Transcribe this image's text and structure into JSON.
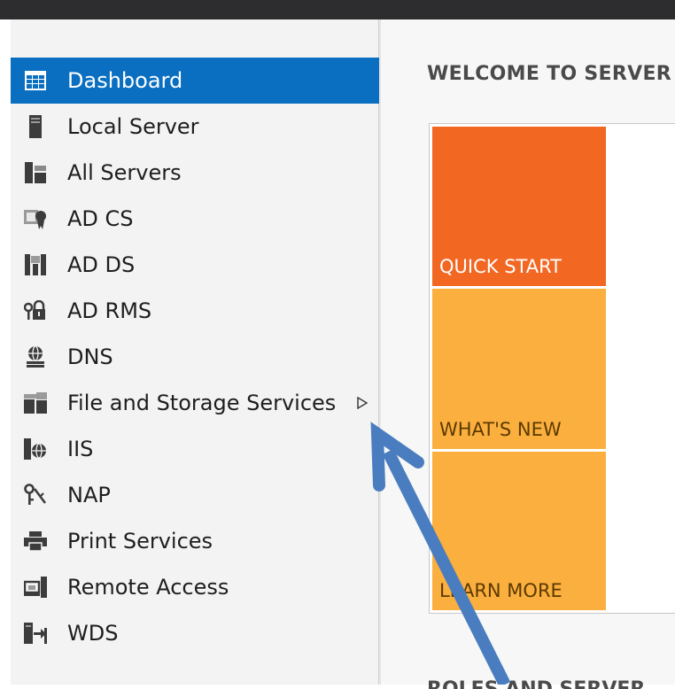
{
  "colors": {
    "titlebar": "#2d2d30",
    "sidebar_bg": "#f3f3f3",
    "active_item_bg": "#0a6fc0",
    "quick_start_tile": "#f26722",
    "whats_new_tile": "#fbaf3f",
    "learn_more_tile": "#fbaf3f",
    "annotation_arrow": "#4a7dbf"
  },
  "sidebar": {
    "items": [
      {
        "label": "Dashboard",
        "icon": "dashboard-icon",
        "active": true
      },
      {
        "label": "Local Server",
        "icon": "local-server-icon"
      },
      {
        "label": "All Servers",
        "icon": "all-servers-icon"
      },
      {
        "label": "AD CS",
        "icon": "certificate-icon"
      },
      {
        "label": "AD DS",
        "icon": "directory-icon"
      },
      {
        "label": "AD RMS",
        "icon": "rights-lock-icon"
      },
      {
        "label": "DNS",
        "icon": "dns-icon"
      },
      {
        "label": "File and Storage Services",
        "icon": "file-storage-icon",
        "expandable": true
      },
      {
        "label": "IIS",
        "icon": "iis-globe-icon"
      },
      {
        "label": "NAP",
        "icon": "nap-keys-icon"
      },
      {
        "label": "Print Services",
        "icon": "printer-icon"
      },
      {
        "label": "Remote Access",
        "icon": "remote-access-icon"
      },
      {
        "label": "WDS",
        "icon": "wds-icon"
      }
    ]
  },
  "main": {
    "welcome_title": "WELCOME TO SERVER",
    "tiles": [
      {
        "label": "QUICK START"
      },
      {
        "label": "WHAT'S NEW"
      },
      {
        "label": "LEARN MORE"
      }
    ],
    "bottom_heading": "ROLES AND SERVER"
  },
  "annotation": {
    "type": "arrow",
    "points_to": "File and Storage Services expand arrow"
  }
}
